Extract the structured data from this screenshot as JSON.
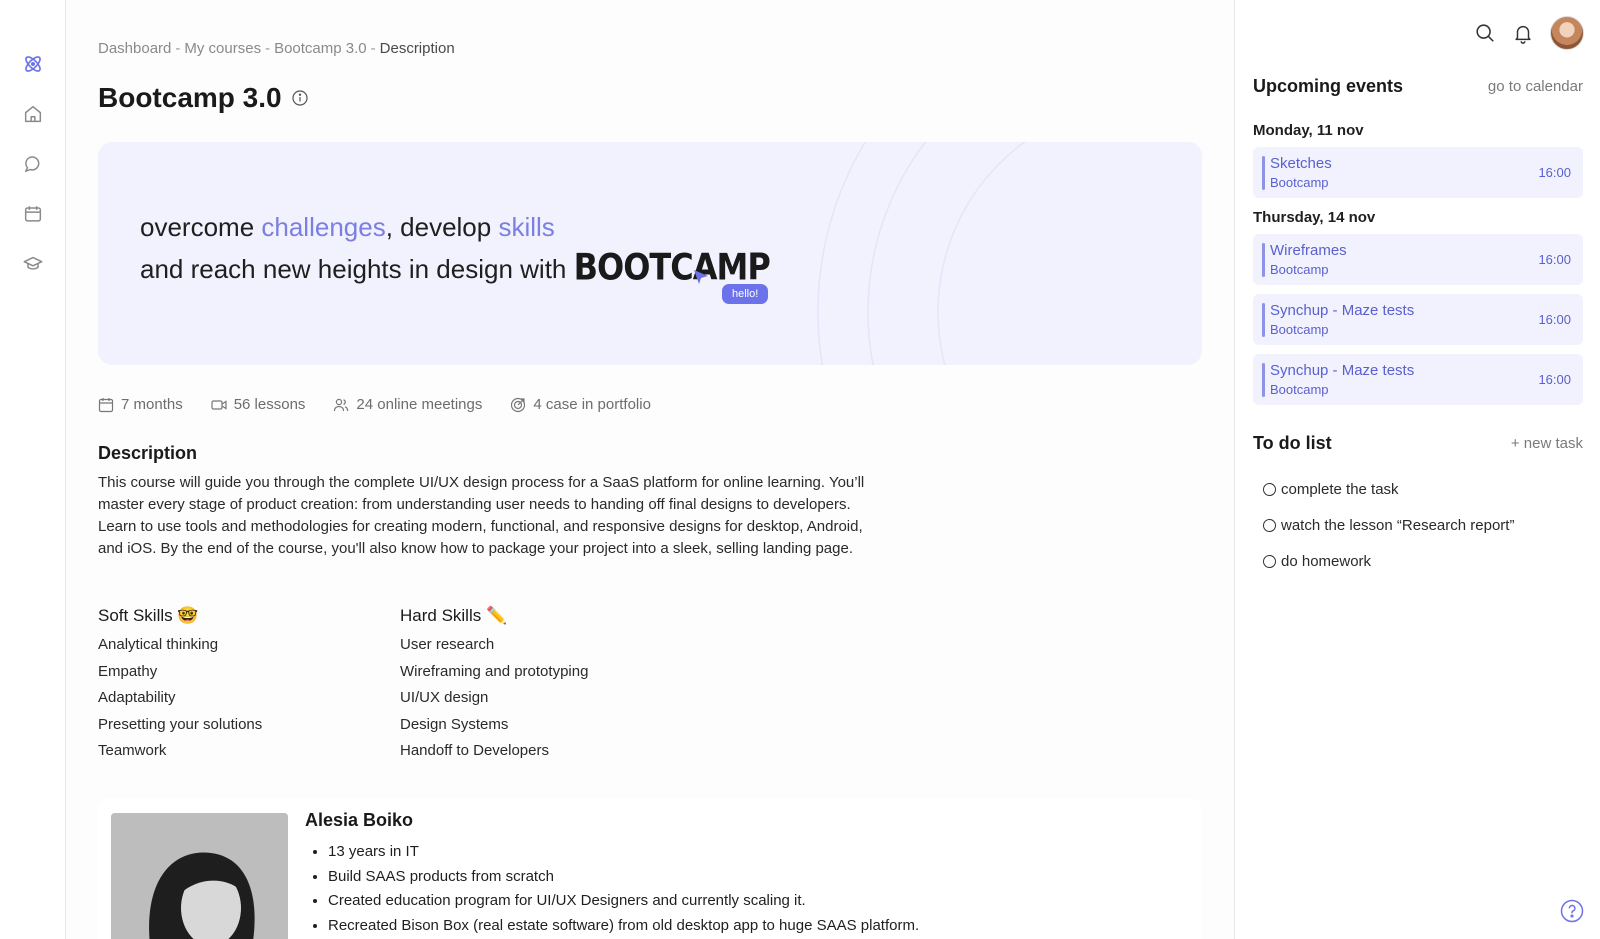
{
  "breadcrumb": [
    "Dashboard",
    "My courses",
    "Bootcamp 3.0",
    "Description"
  ],
  "breadcrumb_sep": "-",
  "page_title": "Bootcamp 3.0",
  "hero": {
    "line1_a": "overcome ",
    "line1_b": "challenges",
    "line1_c": ", develop ",
    "line1_d": "skills",
    "line2_a": "and reach new heights in design with ",
    "brand": "BOOTCAMP",
    "hello": "hello!",
    "accent_color": "#7a7fe0",
    "background": "#f1f2fd"
  },
  "stats": [
    {
      "icon": "calendar-icon",
      "label": "7 months"
    },
    {
      "icon": "video-icon",
      "label": "56 lessons"
    },
    {
      "icon": "users-icon",
      "label": "24 online meetings"
    },
    {
      "icon": "target-icon",
      "label": "4 case in portfolio"
    }
  ],
  "description": {
    "heading": "Description",
    "text": "This course will guide you through the complete UI/UX design process for a SaaS platform for online learning. You’ll master every stage of product creation: from understanding user needs to handing off final designs to developers. Learn to use tools and methodologies for creating modern, functional, and responsive designs for desktop, Android, and iOS. By the end of the course, you'll also know how to package your project into a sleek, selling landing page."
  },
  "soft_skills": {
    "heading": "Soft Skills 🤓",
    "items": [
      "Analytical thinking",
      "Empathy",
      "Adaptability",
      "Presetting your solutions",
      "Teamwork"
    ]
  },
  "hard_skills": {
    "heading": "Hard Skills ✏️",
    "items": [
      "User research",
      "Wireframing and prototyping",
      "UI/UX design",
      "Design Systems",
      "Handoff to Developers"
    ]
  },
  "mentor": {
    "name": "Alesia Boiko",
    "facts": [
      "13 years in IT",
      "Build SAAS products from scratch",
      "Created education program for UI/UX Designers and currently scaling it.",
      "Recreated Bison Box (real estate software) from old desktop app to huge SAAS platform."
    ]
  },
  "events": {
    "heading": "Upcoming events",
    "link": "go to calendar",
    "days": [
      {
        "label": "Monday, 11 nov",
        "items": [
          {
            "name": "Sketches",
            "sub": "Bootcamp",
            "time": "16:00"
          }
        ]
      },
      {
        "label": "Thursday, 14 nov",
        "items": [
          {
            "name": "Wireframes",
            "sub": "Bootcamp",
            "time": "16:00"
          },
          {
            "name": "Synchup - Maze tests",
            "sub": "Bootcamp",
            "time": "16:00"
          },
          {
            "name": "Synchup - Maze tests",
            "sub": "Bootcamp",
            "time": "16:00"
          }
        ]
      }
    ]
  },
  "todo": {
    "heading": "To do list",
    "new_task": "+ new task",
    "items": [
      "complete the task",
      "watch the lesson “Research report”",
      "do homework"
    ]
  }
}
